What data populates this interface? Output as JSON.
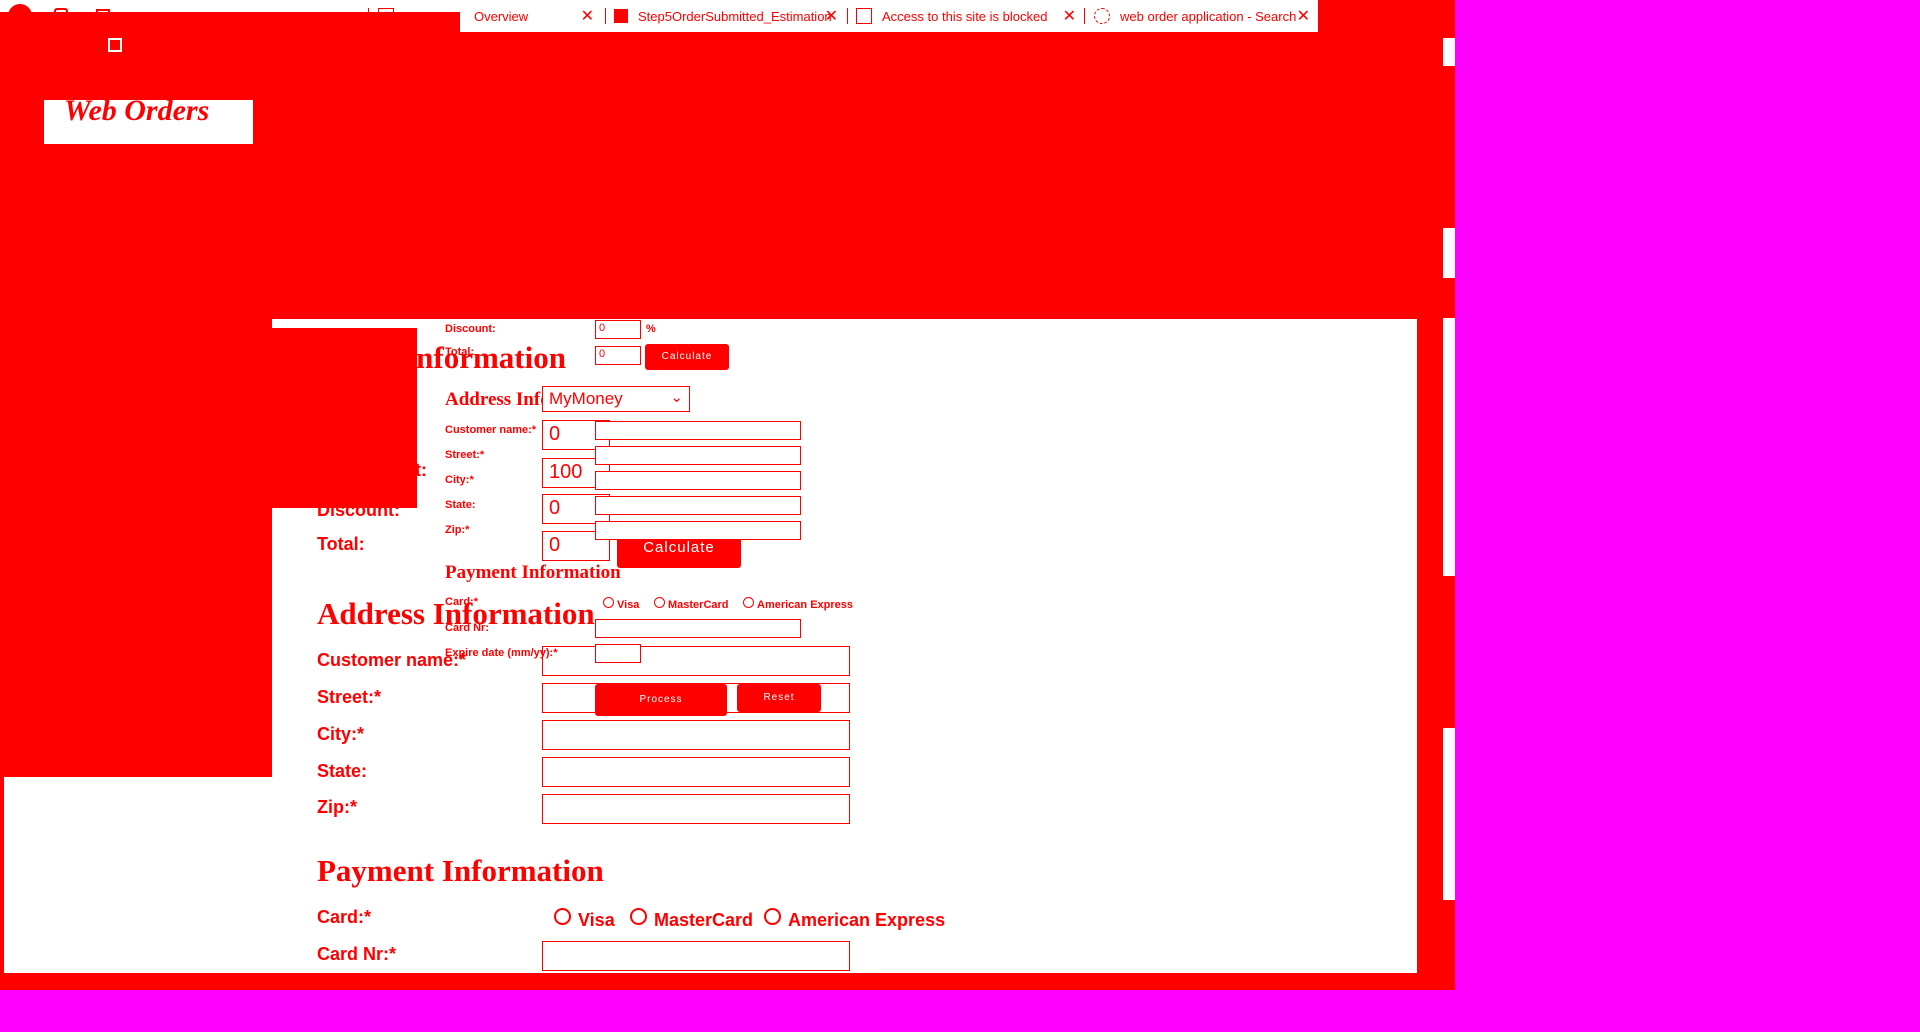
{
  "tabs": [
    {
      "label": "Overview"
    },
    {
      "label": "Step5OrderSubmitted_Estimation"
    },
    {
      "label": "Access to this site is blocked"
    },
    {
      "label": "web order application - Search"
    }
  ],
  "logo_text": "Web Orders",
  "big_form": {
    "heading_product": "Product Information",
    "heading_product_visible": "t Information",
    "label_price_per_unit_visible": "it:",
    "label_discount": "Discount:",
    "label_total": "Total:",
    "quantity_value": "0",
    "price_value": "100",
    "discount_value": "0",
    "percent": "%",
    "total_value": "0",
    "calculate_label": "Calculate",
    "heading_address": "Address Information",
    "label_customer_name": "Customer name:*",
    "label_street": "Street:*",
    "label_city": "City:*",
    "label_state": "State:",
    "label_zip": "Zip:*",
    "heading_payment": "Payment Information",
    "label_card": "Card:*",
    "card_options": [
      "Visa",
      "MasterCard",
      "American Express"
    ],
    "label_card_nr": "Card Nr:*"
  },
  "small_form": {
    "label_discount": "Discount:",
    "discount_value": "0",
    "percent": "%",
    "label_total": "Total:",
    "total_value": "0",
    "calculate_label": "Calculate",
    "heading_address": "Address Information",
    "product_select_value": "MyMoney",
    "label_customer_name": "Customer name:*",
    "label_street": "Street:*",
    "label_city": "City:*",
    "label_state": "State:",
    "label_zip": "Zip:*",
    "heading_payment": "Payment Information",
    "label_card": "Card:*",
    "card_options": [
      "Visa",
      "MasterCard",
      "American Express"
    ],
    "label_card_nr": "Card Nr:",
    "label_expire": "Expire date (mm/yy):*",
    "process_label": "Process",
    "reset_label": "Reset"
  }
}
